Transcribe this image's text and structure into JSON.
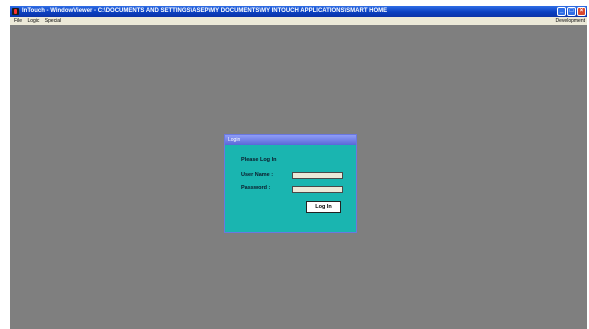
{
  "window": {
    "title": "InTouch - WindowViewer - C:\\DOCUMENTS AND SETTINGS\\ASEP\\MY DOCUMENTS\\MY INTOUCH APPLICATIONS\\SMART HOME"
  },
  "menubar": {
    "items": [
      "File",
      "Logic",
      "Special"
    ],
    "right_label": "Development"
  },
  "login": {
    "title": "Login",
    "prompt": "Please Log In",
    "username_label": "User Name :",
    "username_value": "",
    "password_label": "Password  :",
    "password_value": "",
    "button_label": "Log In"
  },
  "colors": {
    "titlebar": "#0a3fc0",
    "workspace": "#7f7f7f",
    "login_panel": "#1ab5b0",
    "login_titlebar": "#6f7de6"
  }
}
